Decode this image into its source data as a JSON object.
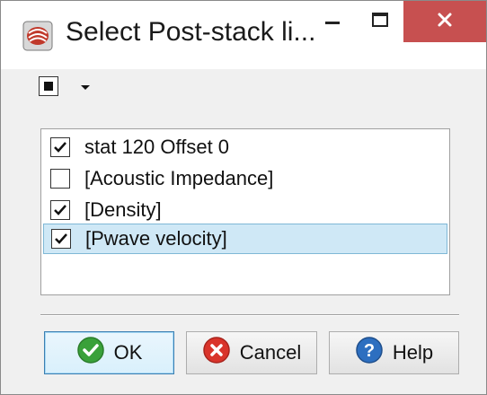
{
  "window": {
    "title": "Select Post-stack li...",
    "app_icon": "app-logo-icon",
    "controls": {
      "minimize_icon": "minimize-icon",
      "maximize_icon": "maximize-icon",
      "close_icon": "close-icon",
      "close_color": "#c75050"
    }
  },
  "toolbar": {
    "select_all_state": "partial",
    "dropdown_icon": "chevron-down-icon"
  },
  "list": {
    "items": [
      {
        "label": "stat 120 Offset 0",
        "checked": true,
        "selected": false
      },
      {
        "label": "[Acoustic Impedance]",
        "checked": false,
        "selected": false
      },
      {
        "label": "[Density]",
        "checked": true,
        "selected": false
      },
      {
        "label": "[Pwave velocity]",
        "checked": true,
        "selected": true
      }
    ],
    "selection_color": "#cfe8f6"
  },
  "buttons": {
    "ok_label": "OK",
    "cancel_label": "Cancel",
    "help_label": "Help",
    "ok_icon": "check-circle-icon",
    "cancel_icon": "x-circle-icon",
    "help_icon": "question-circle-icon"
  }
}
